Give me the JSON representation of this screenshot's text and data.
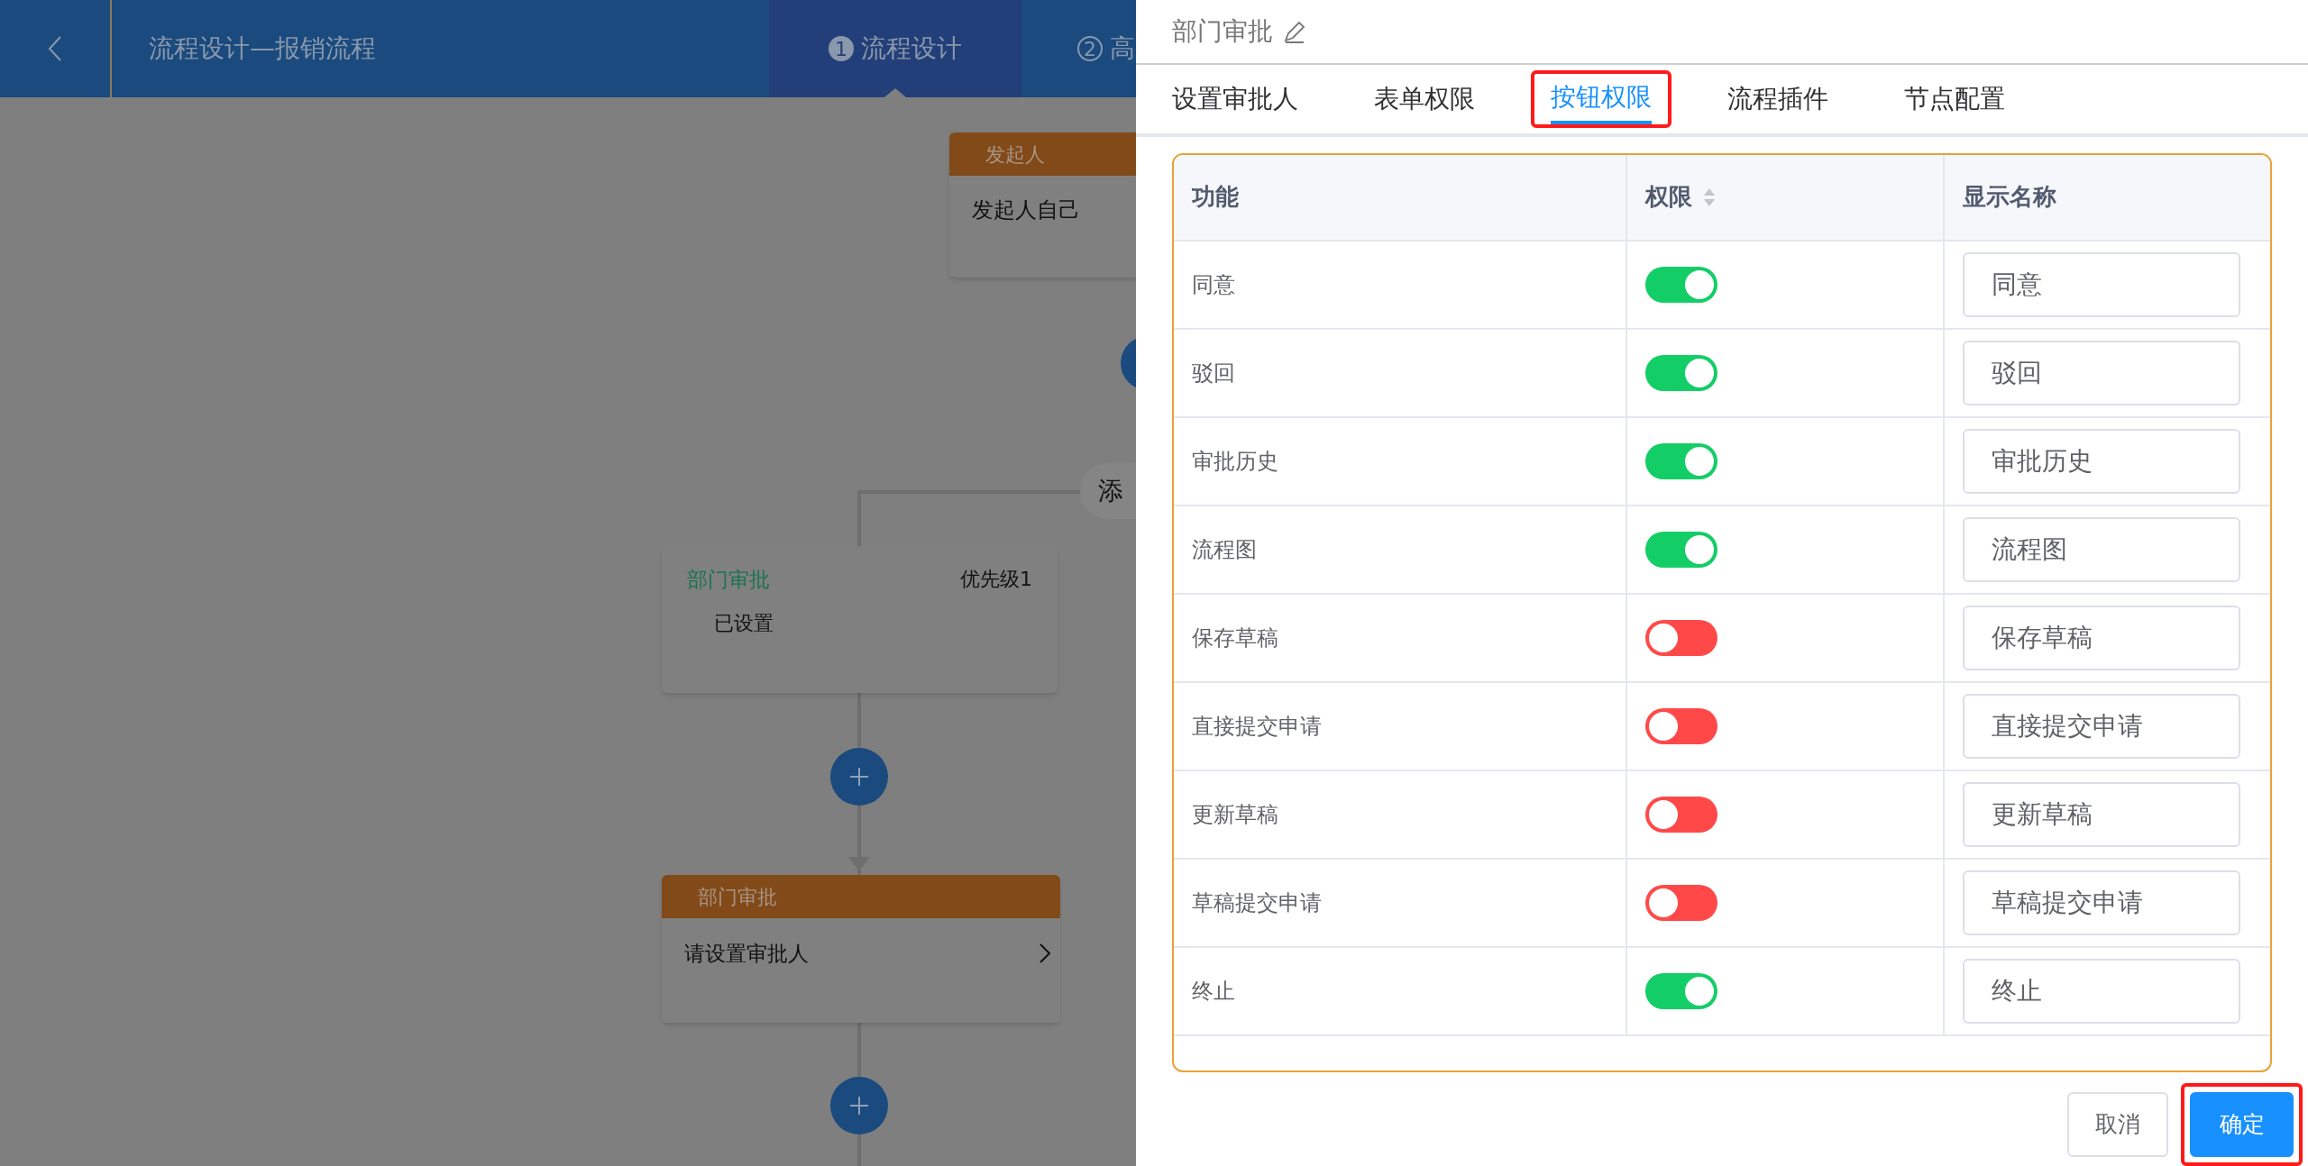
{
  "header": {
    "title": "流程设计—报销流程",
    "steps": [
      {
        "number": "1",
        "label": "流程设计",
        "selected": true
      },
      {
        "number": "2",
        "label": "高",
        "selected": false
      }
    ]
  },
  "canvas": {
    "start_node": {
      "header": "发起人",
      "body": "发起人自己"
    },
    "add_pill": "添",
    "branch_node": {
      "title": "部门审批",
      "priority": "优先级1",
      "body": "已设置"
    },
    "approver_node": {
      "header": "部门审批",
      "body": "请设置审批人"
    }
  },
  "drawer": {
    "title": "部门审批",
    "tabs": [
      {
        "label": "设置审批人",
        "selected": false,
        "annotated": false
      },
      {
        "label": "表单权限",
        "selected": false,
        "annotated": false
      },
      {
        "label": "按钮权限",
        "selected": true,
        "annotated": true
      },
      {
        "label": "流程插件",
        "selected": false,
        "annotated": false
      },
      {
        "label": "节点配置",
        "selected": false,
        "annotated": false
      }
    ],
    "table": {
      "columns": [
        "功能",
        "权限",
        "显示名称"
      ],
      "rows": [
        {
          "function": "同意",
          "on": true,
          "display_name": "同意"
        },
        {
          "function": "驳回",
          "on": true,
          "display_name": "驳回"
        },
        {
          "function": "审批历史",
          "on": true,
          "display_name": "审批历史"
        },
        {
          "function": "流程图",
          "on": true,
          "display_name": "流程图"
        },
        {
          "function": "保存草稿",
          "on": false,
          "display_name": "保存草稿"
        },
        {
          "function": "直接提交申请",
          "on": false,
          "display_name": "直接提交申请"
        },
        {
          "function": "更新草稿",
          "on": false,
          "display_name": "更新草稿"
        },
        {
          "function": "草稿提交申请",
          "on": false,
          "display_name": "草稿提交申请"
        },
        {
          "function": "终止",
          "on": true,
          "display_name": "终止"
        }
      ]
    },
    "buttons": [
      {
        "label": "取消",
        "kind": "default",
        "annotated": false
      },
      {
        "label": "确定",
        "kind": "primary",
        "annotated": true
      }
    ]
  }
}
